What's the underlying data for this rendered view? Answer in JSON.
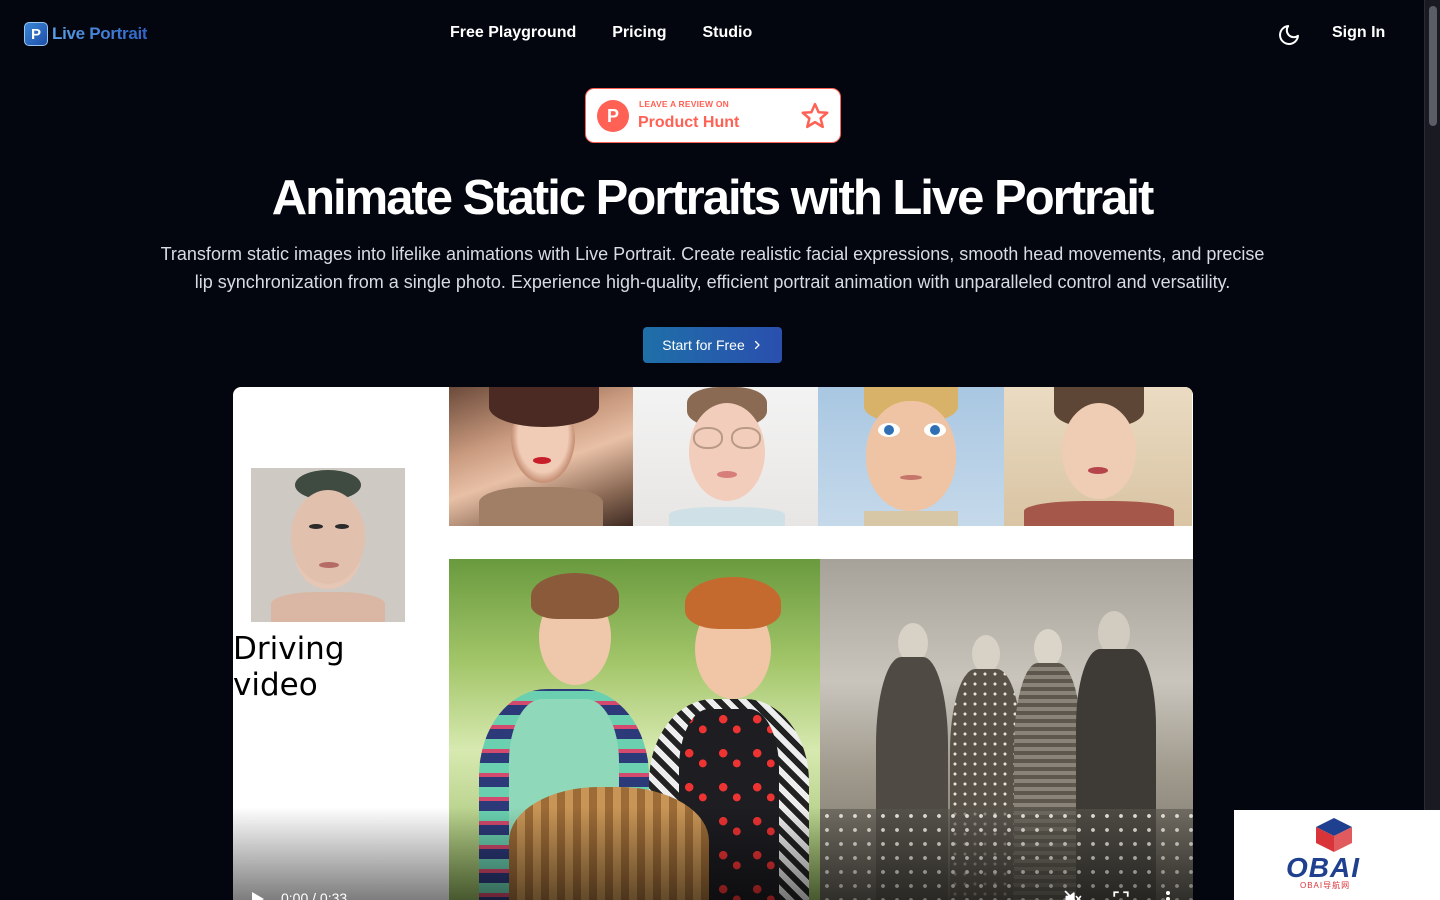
{
  "header": {
    "logo_text": "Live Portrait",
    "logo_mark": "P",
    "nav": [
      "Free Playground",
      "Pricing",
      "Studio"
    ],
    "theme_icon": "moon-icon",
    "sign_in": "Sign In"
  },
  "badge": {
    "small": "LEAVE A REVIEW ON",
    "big": "Product Hunt",
    "letter": "P",
    "color": "#ff6154"
  },
  "hero": {
    "title": "Animate Static Portraits with Live Portrait",
    "description": "Transform static images into lifelike animations with Live Portrait. Create realistic facial expressions, smooth head movements, and precise lip synchronization from a single photo. Experience high-quality, efficient portrait animation with unparalleled control and versatility.",
    "cta": "Start for Free"
  },
  "video": {
    "driving_label": "Driving video",
    "time": "0:00 / 0:33",
    "portraits_top": [
      "portrait-woman-red-lips",
      "portrait-boy-glasses",
      "portrait-cartoon-boy",
      "portrait-vintage-woman"
    ],
    "portraits_bottom": [
      "photo-two-women-basket",
      "photo-vintage-group"
    ]
  },
  "watermark": {
    "text": "OBAI",
    "sub": "OBAI导航网"
  }
}
